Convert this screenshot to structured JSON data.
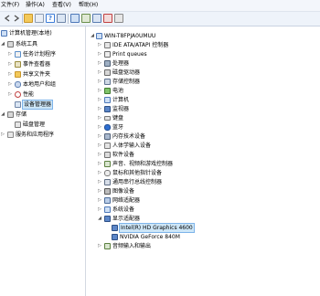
{
  "menu": [
    "文件(F)",
    "操作(A)",
    "查看(V)",
    "帮助(H)"
  ],
  "toolbar_icons": [
    "back-icon",
    "forward-icon",
    "folder-icon",
    "properties-icon",
    "help-icon",
    "view-icon",
    "computer-icon",
    "monitor-icon",
    "update-icon",
    "uninstall-icon",
    "disable-icon"
  ],
  "left_tree": {
    "root": "计算机管理(本地)",
    "items": [
      {
        "label": "系统工具",
        "level": 1,
        "icon": "tools-icon",
        "expanded": true
      },
      {
        "label": "任务计划程序",
        "level": 2,
        "icon": "task-scheduler-icon"
      },
      {
        "label": "事件查看器",
        "level": 2,
        "icon": "event-viewer-icon"
      },
      {
        "label": "共享文件夹",
        "level": 2,
        "icon": "shared-folder-icon"
      },
      {
        "label": "本地用户和组",
        "level": 2,
        "icon": "users-icon"
      },
      {
        "label": "性能",
        "level": 2,
        "icon": "performance-icon"
      },
      {
        "label": "设备管理器",
        "level": 2,
        "icon": "device-manager-icon",
        "selected": true
      },
      {
        "label": "存储",
        "level": 1,
        "icon": "storage-icon",
        "expanded": true
      },
      {
        "label": "磁盘管理",
        "level": 2,
        "icon": "disk-icon"
      },
      {
        "label": "服务和应用程序",
        "level": 1,
        "icon": "services-icon"
      }
    ]
  },
  "device_tree": {
    "root": "WIN-T8FPJA0UMUU",
    "categories": [
      {
        "label": "IDE ATA/ATAPI 控制器",
        "icon": "ide-icon"
      },
      {
        "label": "Print queues",
        "icon": "printer-icon"
      },
      {
        "label": "处理器",
        "icon": "cpu-icon"
      },
      {
        "label": "磁盘驱动器",
        "icon": "disk-drive-icon"
      },
      {
        "label": "存储控制器",
        "icon": "storage-controller-icon"
      },
      {
        "label": "电池",
        "icon": "battery-icon"
      },
      {
        "label": "计算机",
        "icon": "computer-icon"
      },
      {
        "label": "监视器",
        "icon": "monitor-icon"
      },
      {
        "label": "键盘",
        "icon": "keyboard-icon"
      },
      {
        "label": "蓝牙",
        "icon": "bluetooth-icon"
      },
      {
        "label": "内存技术设备",
        "icon": "memory-icon"
      },
      {
        "label": "人体学输入设备",
        "icon": "hid-icon"
      },
      {
        "label": "软件设备",
        "icon": "software-device-icon"
      },
      {
        "label": "声音、视频和游戏控制器",
        "icon": "sound-icon"
      },
      {
        "label": "鼠标和其他指针设备",
        "icon": "mouse-icon"
      },
      {
        "label": "通用串行总线控制器",
        "icon": "usb-icon"
      },
      {
        "label": "图像设备",
        "icon": "camera-icon"
      },
      {
        "label": "网络适配器",
        "icon": "network-icon"
      },
      {
        "label": "系统设备",
        "icon": "system-device-icon"
      },
      {
        "label": "显示适配器",
        "icon": "display-adapter-icon",
        "expanded": true,
        "children": [
          {
            "label": "Intel(R) HD Graphics 4600",
            "icon": "display-adapter-icon",
            "selected": true
          },
          {
            "label": "NVIDIA GeForce 840M",
            "icon": "display-adapter-icon"
          }
        ]
      },
      {
        "label": "音频输入和输出",
        "icon": "audio-icon"
      }
    ]
  },
  "colors": {
    "selection": "#cde6f7",
    "selection_border": "#7eb4ea",
    "left_accent": "#2a5eb8"
  }
}
